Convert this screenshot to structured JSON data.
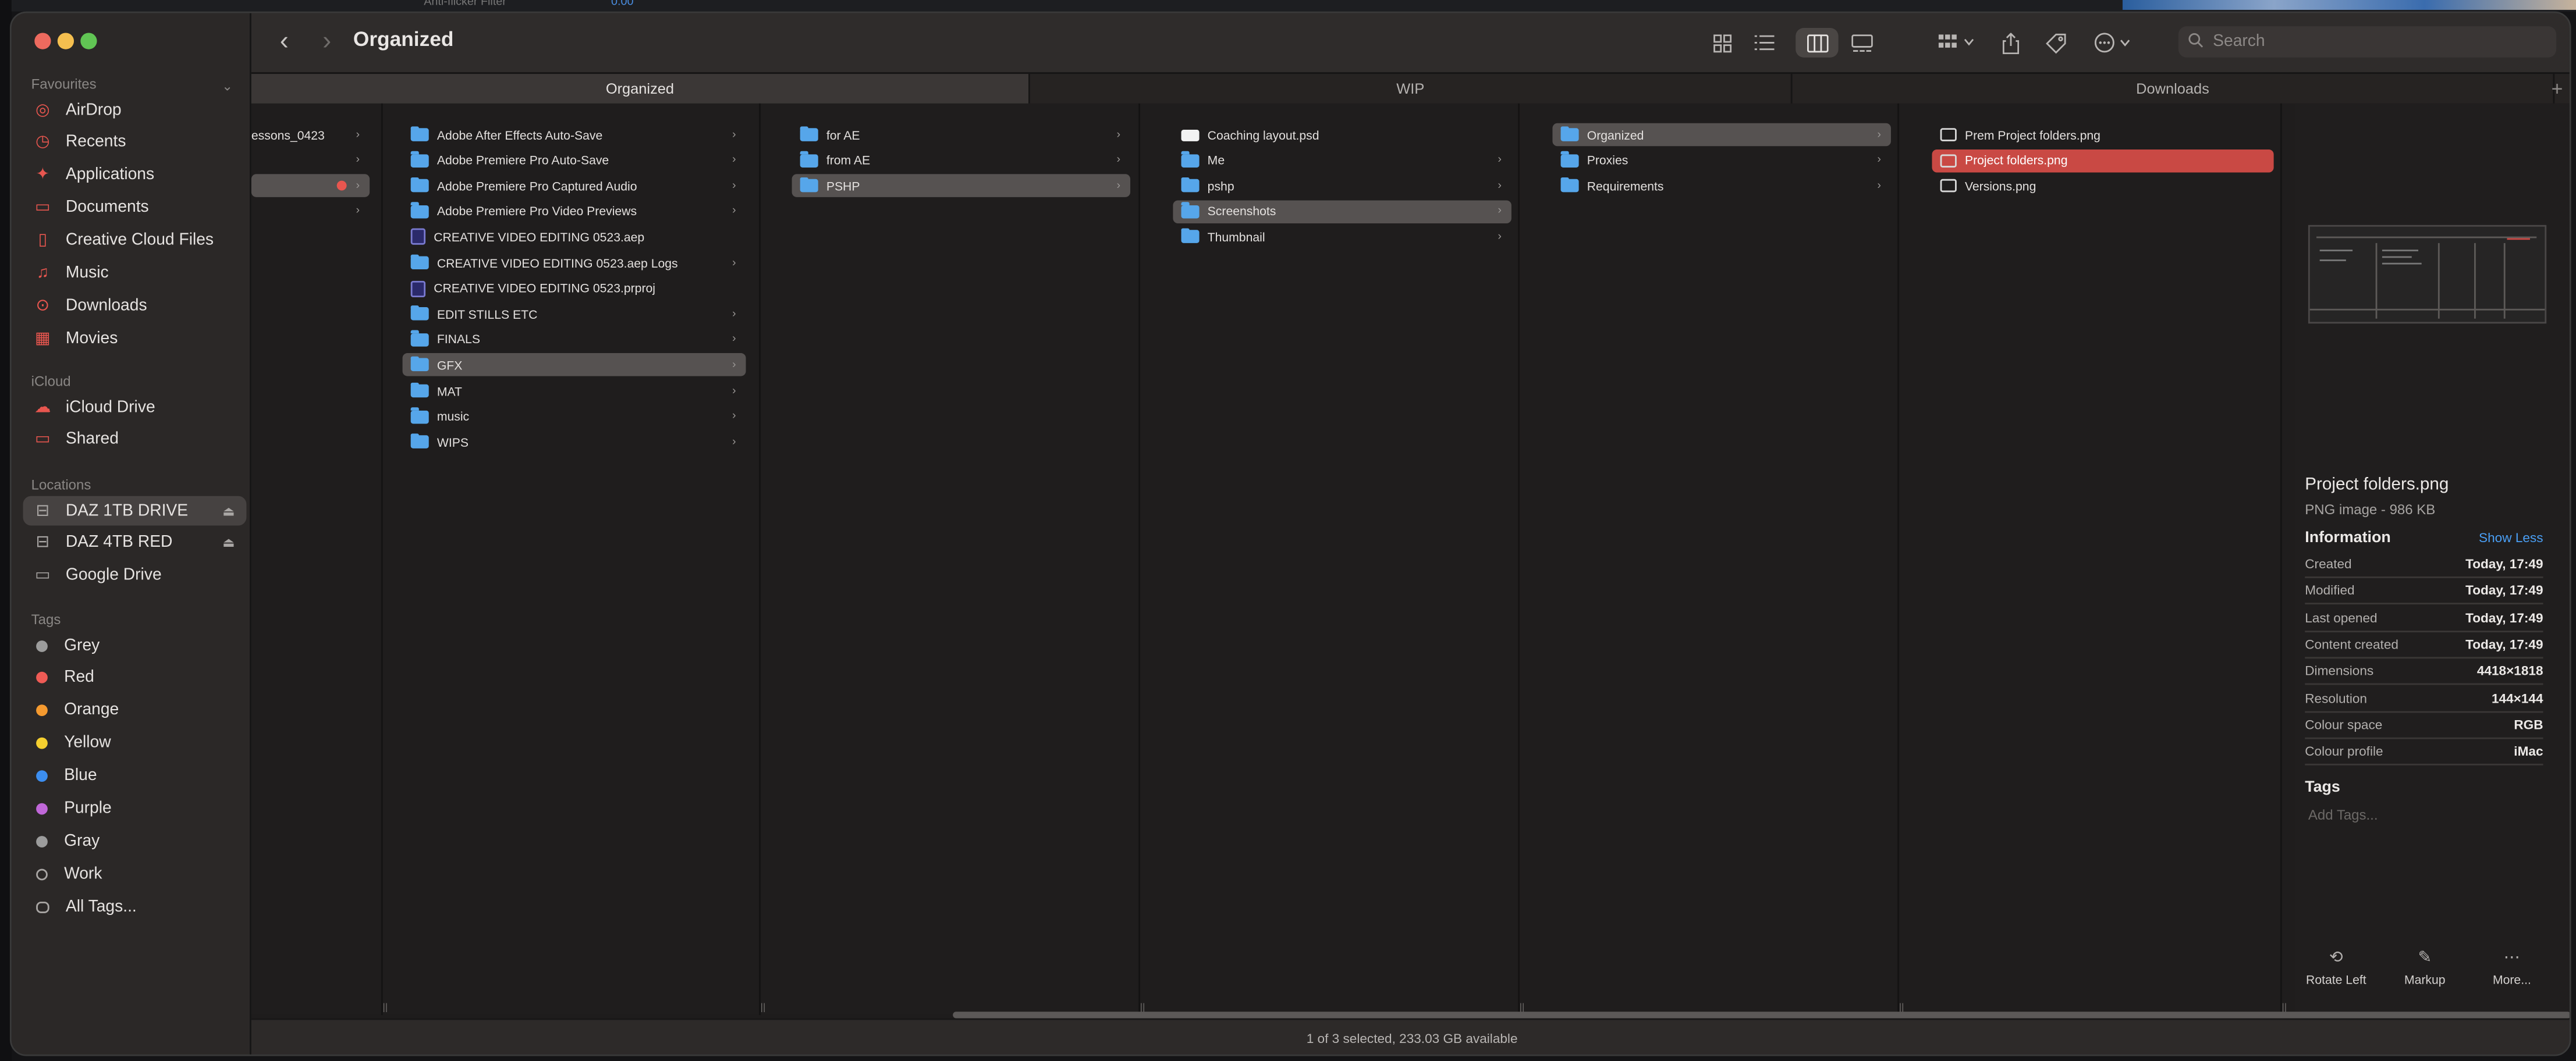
{
  "background_app": {
    "filter_label": "Anti-flicker Filter",
    "filter_value": "0.00"
  },
  "window": {
    "title": "Organized"
  },
  "sidebar": {
    "favourites_label": "Favourites",
    "favourites": [
      {
        "label": "AirDrop",
        "icon": "airdrop-icon",
        "glyph": "◎"
      },
      {
        "label": "Recents",
        "icon": "clock-icon",
        "glyph": "◷"
      },
      {
        "label": "Applications",
        "icon": "applications-icon",
        "glyph": "✦"
      },
      {
        "label": "Documents",
        "icon": "document-icon",
        "glyph": "▭"
      },
      {
        "label": "Creative Cloud Files",
        "icon": "file-icon",
        "glyph": "▯"
      },
      {
        "label": "Music",
        "icon": "music-icon",
        "glyph": "♫"
      },
      {
        "label": "Downloads",
        "icon": "download-icon",
        "glyph": "⊙"
      },
      {
        "label": "Movies",
        "icon": "film-icon",
        "glyph": "▦"
      }
    ],
    "icloud_label": "iCloud",
    "icloud": [
      {
        "label": "iCloud Drive",
        "icon": "cloud-icon",
        "glyph": "☁"
      },
      {
        "label": "Shared",
        "icon": "shared-folder-icon",
        "glyph": "▭"
      }
    ],
    "locations_label": "Locations",
    "locations": [
      {
        "label": "DAZ 1TB DRIVE",
        "icon": "drive-icon",
        "glyph": "⊟",
        "eject": "⏏",
        "selected": true
      },
      {
        "label": "DAZ 4TB RED",
        "icon": "drive-icon",
        "glyph": "⊟",
        "eject": "⏏",
        "selected": false
      },
      {
        "label": "Google Drive",
        "icon": "folder-icon",
        "glyph": "▭",
        "eject": "",
        "selected": false
      }
    ],
    "tags_label": "Tags",
    "tags": [
      {
        "label": "Grey",
        "color": "#9c9c9c"
      },
      {
        "label": "Red",
        "color": "#ef5b55"
      },
      {
        "label": "Orange",
        "color": "#f59a2f"
      },
      {
        "label": "Yellow",
        "color": "#f5cf2f"
      },
      {
        "label": "Blue",
        "color": "#3c8ef0"
      },
      {
        "label": "Purple",
        "color": "#c067d8"
      },
      {
        "label": "Gray",
        "color": "#9c9c9c"
      },
      {
        "label": "Work",
        "color": "transparent"
      },
      {
        "label": "All Tags...",
        "color": "all"
      }
    ]
  },
  "toolbar": {
    "back_icon": "‹",
    "forward_icon": "›",
    "search_placeholder": "Search"
  },
  "tabs": [
    "Organized",
    "WIP",
    "Downloads"
  ],
  "columns": [
    {
      "items": [
        {
          "label": "essons_0423",
          "type": "none",
          "chevron": true
        },
        {
          "label": "",
          "type": "none",
          "chevron": true
        },
        {
          "label": "",
          "type": "none",
          "chevron": true,
          "selected": "grey",
          "tagdot": true
        },
        {
          "label": "",
          "type": "none",
          "chevron": true
        }
      ]
    },
    {
      "items": [
        {
          "label": "Adobe After Effects Auto-Save",
          "type": "folder",
          "chevron": true
        },
        {
          "label": "Adobe Premiere Pro Auto-Save",
          "type": "folder",
          "chevron": true
        },
        {
          "label": "Adobe Premiere Pro Captured Audio",
          "type": "folder",
          "chevron": true
        },
        {
          "label": "Adobe Premiere Pro Video Previews",
          "type": "folder",
          "chevron": true
        },
        {
          "label": "CREATIVE VIDEO EDITING 0523.aep",
          "type": "doc",
          "chevron": false
        },
        {
          "label": "CREATIVE VIDEO EDITING 0523.aep Logs",
          "type": "folder",
          "chevron": true
        },
        {
          "label": "CREATIVE VIDEO EDITING 0523.prproj",
          "type": "doc",
          "chevron": false
        },
        {
          "label": "EDIT STILLS ETC",
          "type": "folder",
          "chevron": true
        },
        {
          "label": "FINALS",
          "type": "folder",
          "chevron": true
        },
        {
          "label": "GFX",
          "type": "folder",
          "chevron": true,
          "selected": "grey"
        },
        {
          "label": "MAT",
          "type": "folder",
          "chevron": true
        },
        {
          "label": "music",
          "type": "folder",
          "chevron": true
        },
        {
          "label": "WIPS",
          "type": "folder",
          "chevron": true
        }
      ]
    },
    {
      "items": [
        {
          "label": "for AE",
          "type": "folder",
          "chevron": true
        },
        {
          "label": "from AE",
          "type": "folder",
          "chevron": true
        },
        {
          "label": "PSHP",
          "type": "folder",
          "chevron": true,
          "selected": "grey"
        }
      ]
    },
    {
      "items": [
        {
          "label": "Coaching layout.psd",
          "type": "psd",
          "chevron": false
        },
        {
          "label": "Me",
          "type": "folder",
          "chevron": true
        },
        {
          "label": "pshp",
          "type": "folder",
          "chevron": true
        },
        {
          "label": "Screenshots",
          "type": "folder",
          "chevron": true,
          "selected": "grey"
        },
        {
          "label": "Thumbnail",
          "type": "folder",
          "chevron": true
        }
      ]
    },
    {
      "items": [
        {
          "label": "Organized",
          "type": "folder",
          "chevron": true,
          "selected": "grey"
        },
        {
          "label": "Proxies",
          "type": "folder",
          "chevron": true
        },
        {
          "label": "Requirements",
          "type": "folder",
          "chevron": true
        }
      ]
    },
    {
      "items": [
        {
          "label": "Prem Project folders.png",
          "type": "png",
          "chevron": false
        },
        {
          "label": "Project folders.png",
          "type": "png",
          "chevron": false,
          "selected": "red"
        },
        {
          "label": "Versions.png",
          "type": "png",
          "chevron": false
        }
      ]
    }
  ],
  "preview": {
    "name": "Project folders.png",
    "subtitle": "PNG image - 986 KB",
    "information_label": "Information",
    "show_less": "Show Less",
    "info": [
      {
        "key": "Created",
        "value": "Today, 17:49"
      },
      {
        "key": "Modified",
        "value": "Today, 17:49"
      },
      {
        "key": "Last opened",
        "value": "Today, 17:49"
      },
      {
        "key": "Content created",
        "value": "Today, 17:49"
      },
      {
        "key": "Dimensions",
        "value": "4418×1818"
      },
      {
        "key": "Resolution",
        "value": "144×144"
      },
      {
        "key": "Colour space",
        "value": "RGB"
      },
      {
        "key": "Colour profile",
        "value": "iMac"
      }
    ],
    "tags_label": "Tags",
    "add_tags": "Add Tags...",
    "actions": [
      {
        "label": "Rotate Left",
        "icon": "rotate-left-icon",
        "glyph": "⟲"
      },
      {
        "label": "Markup",
        "icon": "markup-icon",
        "glyph": "✎"
      },
      {
        "label": "More...",
        "icon": "more-icon",
        "glyph": "⋯"
      }
    ]
  },
  "status": "1 of 3 selected, 233.03 GB available"
}
